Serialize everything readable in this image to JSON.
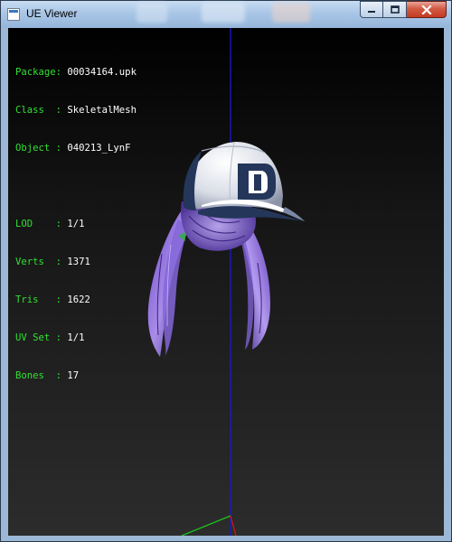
{
  "window": {
    "title": "UE Viewer"
  },
  "info": {
    "package": {
      "key": "Package: ",
      "value": "00034164.upk"
    },
    "class": {
      "key": "Class  : ",
      "value": "SkeletalMesh"
    },
    "object": {
      "key": "Object : ",
      "value": "040213_LynF"
    },
    "lod": {
      "key": "LOD    : ",
      "value": "1/1"
    },
    "verts": {
      "key": "Verts  : ",
      "value": "1371"
    },
    "tris": {
      "key": "Tris   : ",
      "value": "1622"
    },
    "uvset": {
      "key": "UV Set : ",
      "value": "1/1"
    },
    "bones": {
      "key": "Bones  : ",
      "value": "17"
    }
  },
  "colors": {
    "label_green": "#33e033",
    "axis_blue": "#1a1acc",
    "cap_navy": "#24365a",
    "hair_purple": "#7a4fcf"
  }
}
